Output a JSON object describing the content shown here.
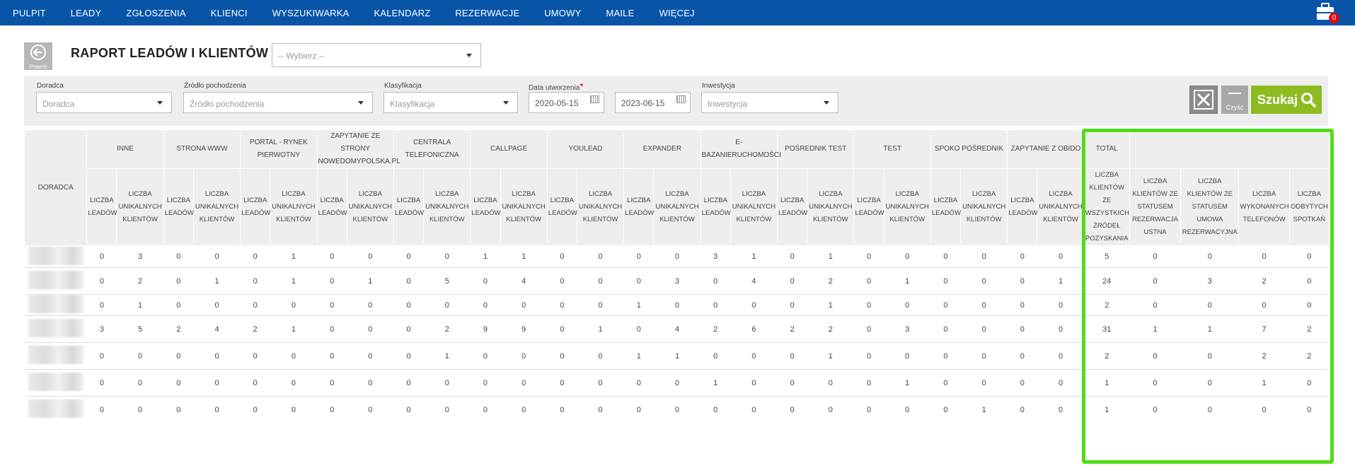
{
  "nav": {
    "items": [
      "PULPIT",
      "LEADY",
      "ZGŁOSZENIA",
      "KLIENCI",
      "WYSZUKIWARKA",
      "KALENDARZ",
      "REZERWACJE",
      "UMOWY",
      "MAILE",
      "WIĘCEJ"
    ],
    "cart_count": "0",
    "cart_icon": "briefcase-icon"
  },
  "header": {
    "back_label": "Powrót",
    "title": "RAPORT LEADÓW I KLIENTÓW",
    "select_placeholder": "-- Wybierz --"
  },
  "filters": {
    "doradca_label": "Doradca",
    "doradca_value": "Doradca",
    "zrodlo_label": "Źródło pochodzenia",
    "zrodlo_value": "Źródło pochodzenia",
    "klasyfikacja_label": "Klasyfikacja",
    "klasyfikacja_value": "Klasyfikacja",
    "data_label": "Data utworzenia",
    "required_mark": "*",
    "date_from": "2020-05-15",
    "date_to": "2023-06-15",
    "inwestycja_label": "Inwestycja",
    "inwestycja_value": "Inwestycja",
    "clear_label": "Czyść",
    "search_label": "Szukaj"
  },
  "table": {
    "advisor_header": "DORADCA",
    "groups": [
      {
        "label": "INNE",
        "sub": [
          "LICZBA LEADÓW",
          "LICZBA UNIKALNYCH KLIENTÓW"
        ]
      },
      {
        "label": "STRONA WWW",
        "sub": [
          "LICZBA LEADÓW",
          "LICZBA UNIKALNYCH KLIENTÓW"
        ]
      },
      {
        "label": "PORTAL - RYNEK PIERWOTNY",
        "sub": [
          "LICZBA LEADÓW",
          "LICZBA UNIKALNYCH KLIENTÓW"
        ]
      },
      {
        "label": "ZAPYTANIE ZE STRONY NOWEDOMYPOLSKA.PL",
        "sub": [
          "LICZBA LEADÓW",
          "LICZBA UNIKALNYCH KLIENTÓW"
        ]
      },
      {
        "label": "CENTRALA TELEFONICZNA",
        "sub": [
          "LICZBA LEADÓW",
          "LICZBA UNIKALNYCH KLIENTÓW"
        ]
      },
      {
        "label": "CALLPAGE",
        "sub": [
          "LICZBA LEADÓW",
          "LICZBA UNIKALNYCH KLIENTÓW"
        ]
      },
      {
        "label": "YOULEAD",
        "sub": [
          "LICZBA LEADÓW",
          "LICZBA UNIKALNYCH KLIENTÓW"
        ]
      },
      {
        "label": "EXPANDER",
        "sub": [
          "LICZBA LEADÓW",
          "LICZBA UNIKALNYCH KLIENTÓW"
        ]
      },
      {
        "label": "E-BAZANIERUCHOMOŚCI",
        "sub": [
          "LICZBA LEADÓW",
          "LICZBA UNIKALNYCH KLIENTÓW"
        ]
      },
      {
        "label": "POŚREDNIK TEST",
        "sub": [
          "LICZBA LEADÓW",
          "LICZBA UNIKALNYCH KLIENTÓW"
        ]
      },
      {
        "label": "TEST",
        "sub": [
          "LICZBA LEADÓW",
          "LICZBA UNIKALNYCH KLIENTÓW"
        ]
      },
      {
        "label": "SPOKO POŚREDNIK",
        "sub": [
          "LICZBA LEADÓW",
          "LICZBA UNIKALNYCH KLIENTÓW"
        ]
      },
      {
        "label": "ZAPYTANIE Z OBIDO",
        "sub": [
          "LICZBA LEADÓW",
          "LICZBA UNIKALNYCH KLIENTÓW"
        ]
      }
    ],
    "total_label": "TOTAL",
    "total_sub": [
      "LICZBA KLIENTÓW ZE WSZYSTKICH ŹRÓDEŁ POZYSKANIA",
      "LICZBA KLIENTÓW ZE STATUSEM REZERWACJA USTNA",
      "LICZBA KLIENTÓW ZE STATUSEM UMOWA REZERWACYJNA",
      "LICZBA WYKONANYCH TELEFONÓW",
      "LICZBA ODBYTYCH SPOTKAŃ"
    ],
    "rows": [
      [
        "0",
        "3",
        "0",
        "0",
        "0",
        "1",
        "0",
        "0",
        "0",
        "0",
        "1",
        "1",
        "0",
        "0",
        "0",
        "0",
        "3",
        "1",
        "0",
        "1",
        "0",
        "0",
        "0",
        "0",
        "0",
        "0",
        "5",
        "0",
        "0",
        "0",
        "0"
      ],
      [
        "0",
        "2",
        "0",
        "1",
        "0",
        "1",
        "0",
        "1",
        "0",
        "5",
        "0",
        "4",
        "0",
        "0",
        "0",
        "3",
        "0",
        "4",
        "0",
        "2",
        "0",
        "1",
        "0",
        "0",
        "0",
        "1",
        "24",
        "0",
        "3",
        "2",
        "0"
      ],
      [
        "0",
        "1",
        "0",
        "0",
        "0",
        "0",
        "0",
        "0",
        "0",
        "0",
        "0",
        "0",
        "0",
        "0",
        "1",
        "0",
        "0",
        "0",
        "0",
        "1",
        "0",
        "0",
        "0",
        "0",
        "0",
        "0",
        "2",
        "0",
        "0",
        "0",
        "0"
      ],
      [
        "3",
        "5",
        "2",
        "4",
        "2",
        "1",
        "0",
        "0",
        "0",
        "2",
        "9",
        "9",
        "0",
        "1",
        "0",
        "4",
        "2",
        "6",
        "2",
        "2",
        "0",
        "3",
        "0",
        "0",
        "0",
        "0",
        "31",
        "1",
        "1",
        "7",
        "2"
      ],
      [
        "0",
        "0",
        "0",
        "0",
        "0",
        "0",
        "0",
        "0",
        "0",
        "1",
        "0",
        "0",
        "0",
        "0",
        "1",
        "1",
        "0",
        "0",
        "0",
        "1",
        "0",
        "0",
        "0",
        "0",
        "0",
        "0",
        "2",
        "0",
        "0",
        "2",
        "2"
      ],
      [
        "0",
        "0",
        "0",
        "0",
        "0",
        "0",
        "0",
        "0",
        "0",
        "0",
        "0",
        "0",
        "0",
        "0",
        "0",
        "0",
        "1",
        "0",
        "0",
        "0",
        "0",
        "1",
        "0",
        "0",
        "0",
        "0",
        "1",
        "0",
        "0",
        "1",
        "0"
      ],
      [
        "0",
        "0",
        "0",
        "0",
        "0",
        "0",
        "0",
        "0",
        "0",
        "0",
        "0",
        "0",
        "0",
        "0",
        "0",
        "0",
        "0",
        "0",
        "0",
        "0",
        "0",
        "0",
        "0",
        "1",
        "0",
        "0",
        "1",
        "0",
        "0",
        "0",
        "0"
      ]
    ]
  },
  "highlight_color": "#52db17",
  "accent_color": "#0855a8",
  "search_color": "#8dbb22"
}
